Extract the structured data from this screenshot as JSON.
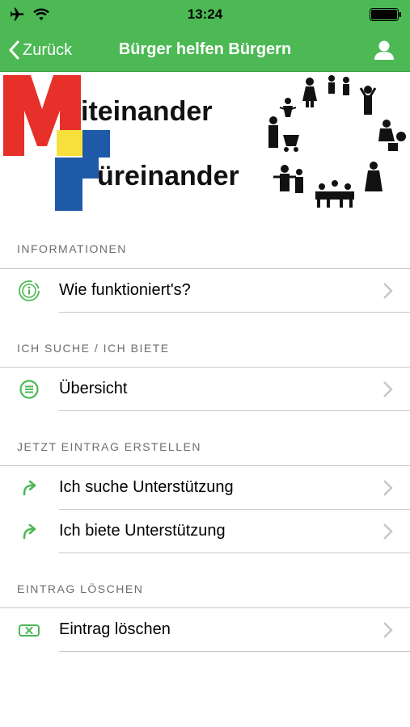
{
  "status": {
    "time": "13:24"
  },
  "nav": {
    "back_label": "Zurück",
    "title": "Bürger helfen Bürgern"
  },
  "banner": {
    "line1": "iteinander",
    "line2": "üreinander",
    "colors": {
      "red": "#e8302a",
      "yellow": "#f7e03c",
      "blue": "#1e5aa8"
    }
  },
  "accent": "#4cb955",
  "sections": [
    {
      "header": "INFORMATIONEN",
      "items": [
        {
          "label": "Wie funktioniert's?",
          "icon": "info-icon"
        }
      ]
    },
    {
      "header": "ICH SUCHE / ICH BIETE",
      "items": [
        {
          "label": "Übersicht",
          "icon": "list-icon"
        }
      ]
    },
    {
      "header": "JETZT EINTRAG ERSTELLEN",
      "items": [
        {
          "label": "Ich suche Unterstützung",
          "icon": "share-arrow-icon"
        },
        {
          "label": "Ich biete Unterstützung",
          "icon": "share-arrow-icon"
        }
      ]
    },
    {
      "header": "EINTRAG LÖSCHEN",
      "items": [
        {
          "label": "Eintrag löschen",
          "icon": "delete-icon"
        }
      ]
    }
  ]
}
